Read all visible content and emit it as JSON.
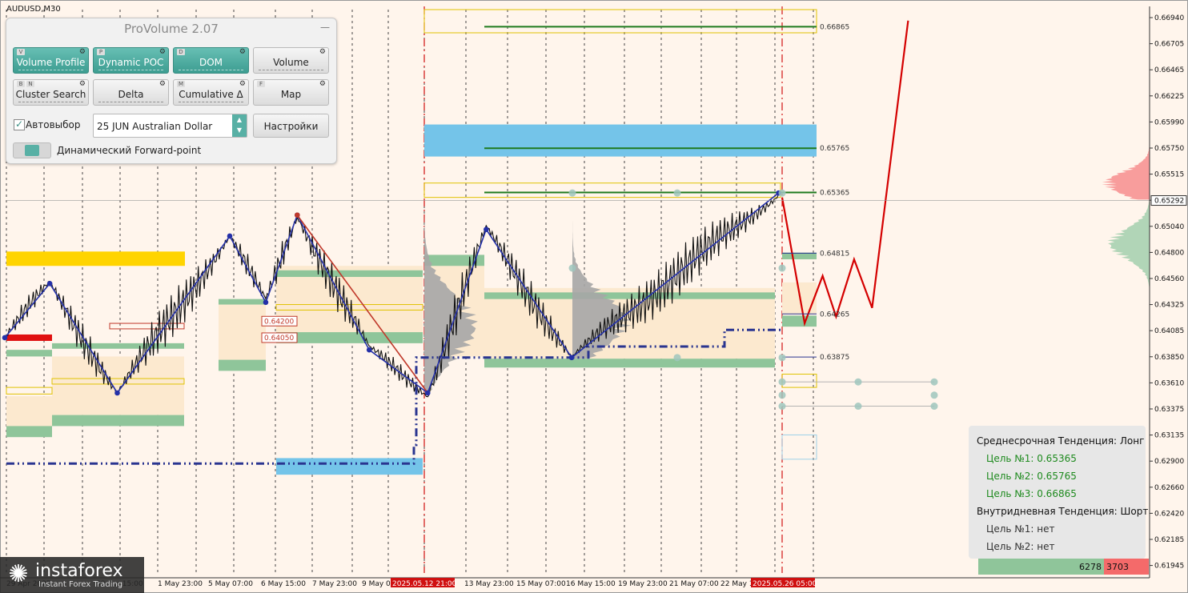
{
  "symbol": {
    "label": "AUDUSD,M30"
  },
  "panel": {
    "title": "ProVolume 2.07",
    "minimize_label": "—",
    "buttons": [
      {
        "label": "Volume Profile",
        "hotkey": "V",
        "active": true
      },
      {
        "label": "Dynamic POC",
        "hotkey": "P",
        "active": true
      },
      {
        "label": "DOM",
        "hotkey": "D",
        "active": true
      },
      {
        "label": "Volume",
        "hotkey": "",
        "active": false
      },
      {
        "label": "Cluster Search",
        "hotkey": "B",
        "hotkey2": "N",
        "active": false
      },
      {
        "label": "Delta",
        "hotkey": "",
        "active": false
      },
      {
        "label": "Cumulative Δ",
        "hotkey": "M",
        "active": false
      },
      {
        "label": "Map",
        "hotkey": "F",
        "active": false
      }
    ],
    "gear_icon": "⚙",
    "autoselect_label": "Автовыбор",
    "autoselect_checked": "✓",
    "contract": "25 JUN Australian Dollar",
    "settings_label": "Настройки",
    "forward_label": "Динамический Forward-point",
    "spin_up": "▲",
    "spin_down": "▼"
  },
  "colors": {
    "background": "#fff5ec",
    "zigzag": "#2430a8",
    "bear_line": "#c0392b",
    "forecast": "#d40000",
    "level_green": "#1e7a1e",
    "zone_blue": "#74c4e9",
    "zone_yellow": "#ffd400",
    "zone_green": "#8fc59a",
    "zone_beige": "#fce9cf",
    "profile_gray": "#a6a6a6",
    "right_profile_green": "#a9d2b1",
    "right_profile_red": "#f79494",
    "teal": "#58b0a5"
  },
  "chart_data": {
    "type": "line",
    "y_axis": {
      "min": 0.6192,
      "max": 0.6702,
      "ticks": [
        "0.66940",
        "0.66705",
        "0.66465",
        "0.66225",
        "0.65990",
        "0.65750",
        "0.65515",
        "0.65292",
        "0.65040",
        "0.64800",
        "0.64560",
        "0.64325",
        "0.64085",
        "0.63850",
        "0.63610",
        "0.63375",
        "0.63135",
        "0.62900",
        "0.62660",
        "0.62420",
        "0.62185",
        "0.61945"
      ],
      "current_price": "0.65292"
    },
    "x_axis": {
      "labels": [
        "29 Apr 2025",
        "30 Apr 15:00",
        "1 May 23:00",
        "5 May 07:00",
        "6 May 15:00",
        "7 May 23:00",
        "9 May 07:00",
        "2025.05.12 21:00",
        "13 May 23:00",
        "15 May 07:00",
        "16 May 15:00",
        "19 May 23:00",
        "21 May 07:00",
        "22 May 15:00",
        "2025.05.26 05:00"
      ],
      "highlight": [
        "2025.05.12 21:00",
        "2025.05.26 05:00"
      ]
    },
    "levels": [
      {
        "price": 0.66865,
        "label": "0.66865"
      },
      {
        "price": 0.65765,
        "label": "0.65765"
      },
      {
        "price": 0.65365,
        "label": "0.65365"
      },
      {
        "price": 0.64815,
        "label": "0.64815"
      },
      {
        "price": 0.64265,
        "label": "0.64265"
      },
      {
        "price": 0.63875,
        "label": "0.63875"
      }
    ],
    "zone_labels": [
      {
        "price": 0.642,
        "label": "0.64200"
      },
      {
        "price": 0.6405,
        "label": "0.64050"
      }
    ],
    "zigzag": [
      [
        0,
        0.6405
      ],
      [
        10,
        0.6454
      ],
      [
        25,
        0.6355
      ],
      [
        50,
        0.6497
      ],
      [
        58,
        0.6437
      ],
      [
        65,
        0.6516
      ],
      [
        81,
        0.6394
      ],
      [
        94,
        0.6355
      ],
      [
        107,
        0.6503
      ],
      [
        126,
        0.6387
      ],
      [
        172,
        0.6536
      ]
    ],
    "bear_line": [
      [
        65,
        0.6516
      ],
      [
        94,
        0.6355
      ]
    ],
    "forecast": [
      [
        172,
        0.6532
      ],
      [
        177,
        0.6418
      ],
      [
        181,
        0.6461
      ],
      [
        184,
        0.6424
      ],
      [
        188,
        0.6476
      ],
      [
        192,
        0.6432
      ],
      [
        200,
        0.6692
      ]
    ],
    "vwap_lower": [
      [
        0,
        0.6291
      ],
      [
        92,
        0.6291
      ],
      [
        92,
        0.6308
      ],
      [
        94,
        0.6308
      ],
      [
        94,
        0.6387
      ],
      [
        130,
        0.6387
      ],
      [
        130,
        0.6397
      ],
      [
        160,
        0.6397
      ],
      [
        160,
        0.6412
      ],
      [
        172,
        0.6412
      ]
    ],
    "volume_footer": {
      "buy": "6278",
      "sell": "3703"
    }
  },
  "trend": {
    "mid_title": "Среднесрочная Тенденция: Лонг",
    "mid_targets": [
      "Цель №1: 0.65365",
      "Цель №2: 0.65765",
      "Цель №3: 0.66865"
    ],
    "intra_title": "Внутридневная Тенденция: Шорт",
    "intra_targets": [
      "Цель №1: нет",
      "Цель №2: нет"
    ]
  },
  "logo": {
    "name": "instaforex",
    "sub": "Instant Forex Trading",
    "mark": "✺"
  }
}
